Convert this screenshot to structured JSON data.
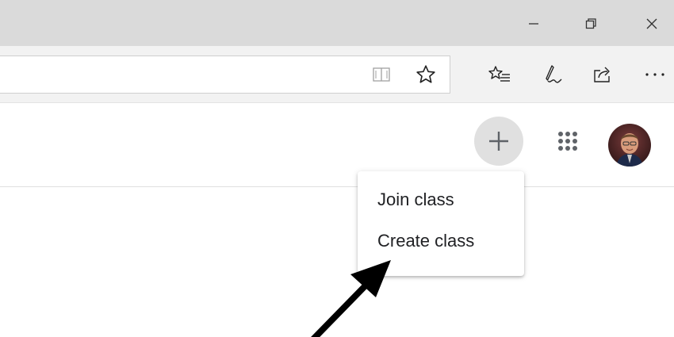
{
  "window_controls": {
    "minimize_icon": "minimize-icon",
    "restore_icon": "restore-icon",
    "close_icon": "close-icon"
  },
  "toolbar": {
    "address_value": "",
    "icons": [
      "reading-view-icon",
      "favorite-star-icon",
      "favorites-list-icon",
      "add-notes-pen-icon",
      "share-icon",
      "more-dots-icon"
    ]
  },
  "header": {
    "create_join_icon": "plus-icon",
    "apps_icon": "apps-grid-icon",
    "avatar_icon": "user-avatar"
  },
  "menu": {
    "items": [
      {
        "label": "Join class"
      },
      {
        "label": "Create class"
      }
    ]
  },
  "annotation": {
    "arrow_icon": "black-arrow-icon",
    "arrow_color": "#000000"
  },
  "colors": {
    "titlebar": "#dadada",
    "toolbar": "#f2f2f2",
    "plus_button_bg": "#e0e0e0",
    "menu_text": "#202124"
  }
}
